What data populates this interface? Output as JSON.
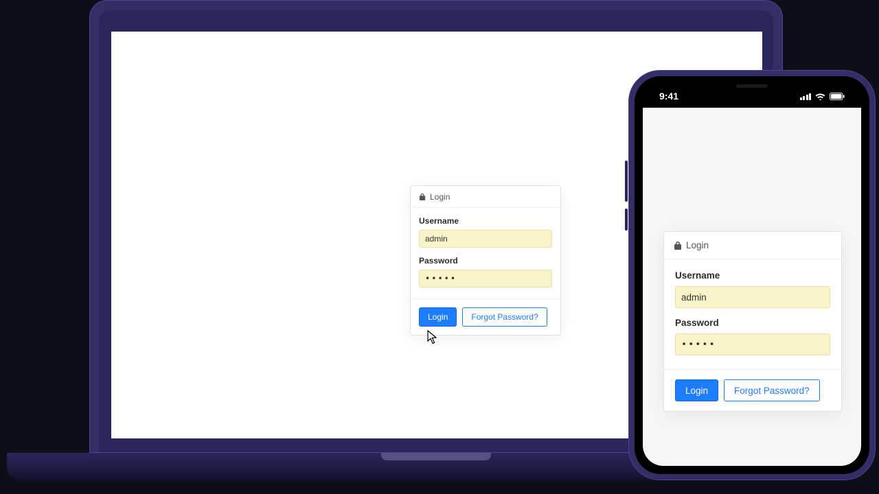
{
  "phone_status": {
    "time": "9:41"
  },
  "login": {
    "title": "Login",
    "username_label": "Username",
    "username_value": "admin",
    "password_label": "Password",
    "password_masked": "•••••",
    "submit_label": "Login",
    "forgot_label": "Forgot Password?"
  }
}
